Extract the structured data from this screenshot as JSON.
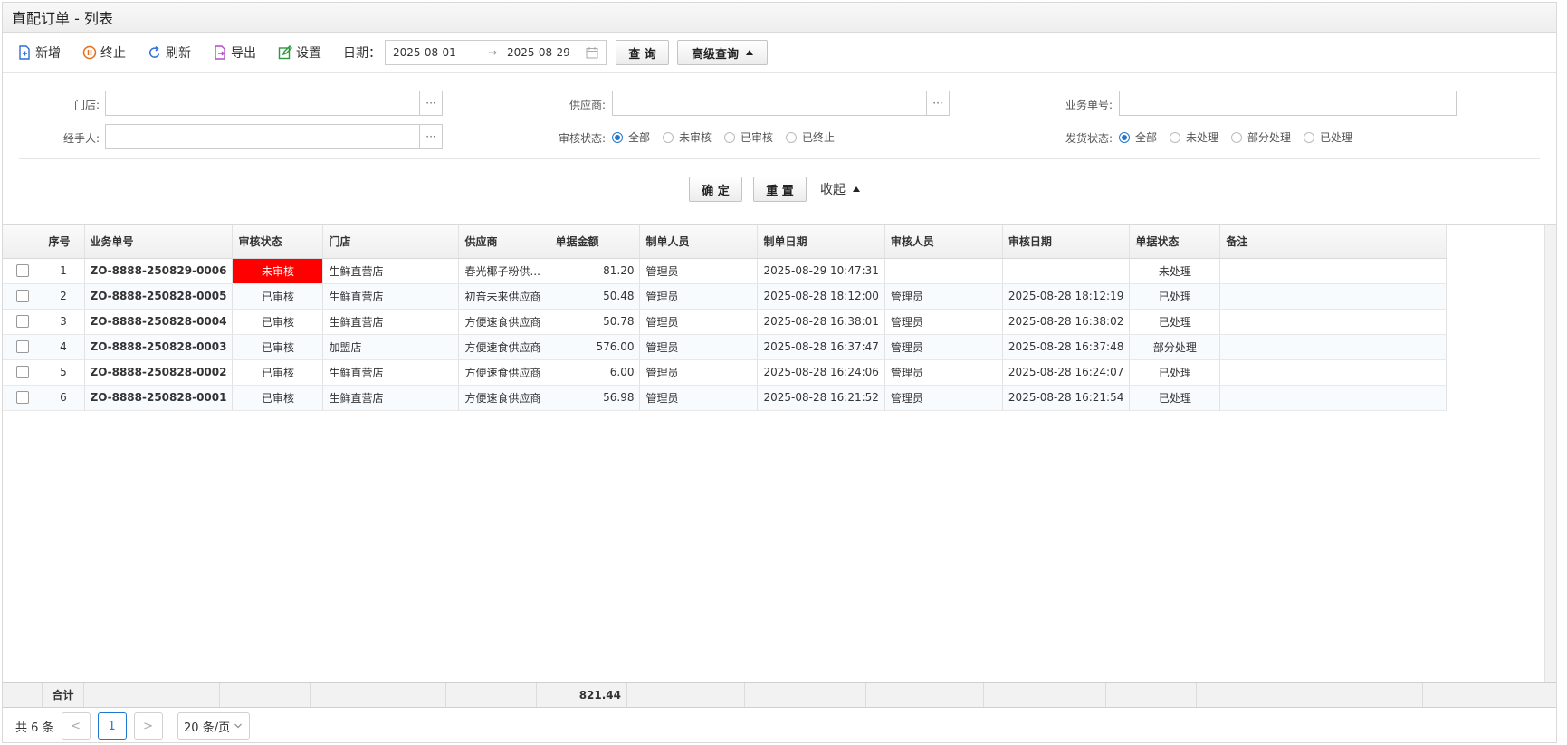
{
  "title": "直配订单 - 列表",
  "toolbar": {
    "add": "新增",
    "stop": "终止",
    "refresh": "刷新",
    "export": "导出",
    "settings": "设置",
    "date_label": "日期：",
    "date_from": "2025-08-01",
    "date_arrow": "→",
    "date_to": "2025-08-29",
    "query": "查 询",
    "advanced": "高级查询"
  },
  "filter": {
    "store_label": "门店:",
    "supplier_label": "供应商:",
    "bizno_label": "业务单号:",
    "handler_label": "经手人:",
    "audit_label": "审核状态:",
    "audit_options": [
      "全部",
      "未审核",
      "已审核",
      "已终止"
    ],
    "audit_selected": "全部",
    "ship_label": "发货状态:",
    "ship_options": [
      "全部",
      "未处理",
      "部分处理",
      "已处理"
    ],
    "ship_selected": "全部",
    "dots": "···",
    "confirm": "确 定",
    "reset": "重 置",
    "collapse": "收起"
  },
  "table": {
    "headers": [
      "序号",
      "业务单号",
      "审核状态",
      "门店",
      "供应商",
      "单据金额",
      "制单人员",
      "制单日期",
      "审核人员",
      "审核日期",
      "单据状态",
      "备注"
    ],
    "rows": [
      {
        "no": "1",
        "bizno": "ZO-8888-250829-0006",
        "audit": "未审核",
        "store": "生鲜直营店",
        "supplier": "春光椰子粉供...",
        "amount": "81.20",
        "creator": "管理员",
        "created": "2025-08-29 10:47:31",
        "auditor": "",
        "audited": "",
        "status": "未处理",
        "remark": ""
      },
      {
        "no": "2",
        "bizno": "ZO-8888-250828-0005",
        "audit": "已审核",
        "store": "生鲜直营店",
        "supplier": "初音未来供应商",
        "amount": "50.48",
        "creator": "管理员",
        "created": "2025-08-28 18:12:00",
        "auditor": "管理员",
        "audited": "2025-08-28 18:12:19",
        "status": "已处理",
        "remark": ""
      },
      {
        "no": "3",
        "bizno": "ZO-8888-250828-0004",
        "audit": "已审核",
        "store": "生鲜直营店",
        "supplier": "方便速食供应商",
        "amount": "50.78",
        "creator": "管理员",
        "created": "2025-08-28 16:38:01",
        "auditor": "管理员",
        "audited": "2025-08-28 16:38:02",
        "status": "已处理",
        "remark": ""
      },
      {
        "no": "4",
        "bizno": "ZO-8888-250828-0003",
        "audit": "已审核",
        "store": "加盟店",
        "supplier": "方便速食供应商",
        "amount": "576.00",
        "creator": "管理员",
        "created": "2025-08-28 16:37:47",
        "auditor": "管理员",
        "audited": "2025-08-28 16:37:48",
        "status": "部分处理",
        "remark": ""
      },
      {
        "no": "5",
        "bizno": "ZO-8888-250828-0002",
        "audit": "已审核",
        "store": "生鲜直营店",
        "supplier": "方便速食供应商",
        "amount": "6.00",
        "creator": "管理员",
        "created": "2025-08-28 16:24:06",
        "auditor": "管理员",
        "audited": "2025-08-28 16:24:07",
        "status": "已处理",
        "remark": ""
      },
      {
        "no": "6",
        "bizno": "ZO-8888-250828-0001",
        "audit": "已审核",
        "store": "生鲜直营店",
        "supplier": "方便速食供应商",
        "amount": "56.98",
        "creator": "管理员",
        "created": "2025-08-28 16:21:52",
        "auditor": "管理员",
        "audited": "2025-08-28 16:21:54",
        "status": "已处理",
        "remark": ""
      }
    ],
    "total_label": "合计",
    "total_amount": "821.44",
    "unaudited_color": "#ff0000"
  },
  "pager": {
    "total": "共 6 条",
    "prev": "<",
    "current": "1",
    "next": ">",
    "page_size": "20 条/页"
  }
}
